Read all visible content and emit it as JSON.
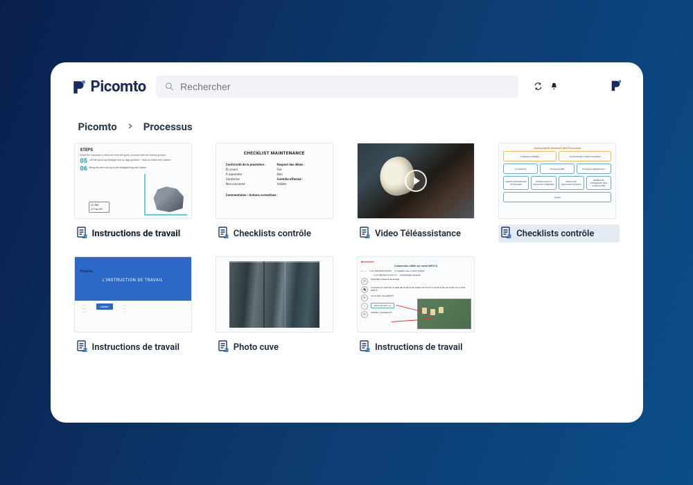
{
  "brand": "Picomto",
  "search": {
    "placeholder": "Rechercher"
  },
  "breadcrumb": {
    "root": "Picomto",
    "current": "Processus"
  },
  "cards": [
    {
      "label": "Instructions de travail",
      "bold": true,
      "selected": false,
      "type": "doc"
    },
    {
      "label": "Checklists contrôle",
      "bold": false,
      "selected": false,
      "type": "doc"
    },
    {
      "label": "Video Téléassistance",
      "bold": false,
      "selected": false,
      "type": "doc"
    },
    {
      "label": "Checklists contrôle",
      "bold": false,
      "selected": true,
      "type": "doc"
    },
    {
      "label": "Instructions de travail",
      "bold": false,
      "selected": false,
      "type": "doc"
    },
    {
      "label": "Photo cuve",
      "bold": false,
      "selected": false,
      "type": "doc"
    },
    {
      "label": "Instructions de travail",
      "bold": false,
      "selected": false,
      "type": "doc"
    }
  ],
  "thumbs": {
    "steps": {
      "title": "STEPS",
      "subtitle": "When the substrate is removed from the guest, proceed with the following steps",
      "s5": "Lift the spool up (straight arm on high position – stop on choke end), button",
      "s6": "Bring the wire end up to the straightening unit, button",
      "chk1": "HMI",
      "chk2": "Pay-off"
    },
    "checkm": {
      "title": "CHECKLIST MAINTENANCE",
      "l1": "Conformité de la prestation :",
      "l2": "En cours",
      "l3": "À reprendre",
      "l4": "Conforme",
      "l5": "Non concerné",
      "r1": "Respect des délais :",
      "r2": "Oui",
      "r3": "Non",
      "r4": "Contrôle effectué :",
      "r5": "Valider",
      "corr": "Commentaires / Actions correctives :"
    },
    "pmap": {
      "title": "Cartographie Générale des Processus",
      "b11": "Politique & stratégie",
      "b12": "Communication interne et externe",
      "b21": "Commercial",
      "b22": "Processus R&D",
      "b23": "Processus opérationnel 1",
      "b31": "Gestion administrative et financière",
      "b32": "Infrastructures et ressources matérielles",
      "b33": "Gestion des ressources humaines",
      "b34": "Système de management de la qualité et RSE",
      "b41": "Achats"
    },
    "inst2": {
      "logo": "Picomto",
      "banner": "L'INSTRUCTION DE TRAVAIL",
      "btn": "Valider"
    },
    "soco": {
      "brand": "socomec",
      "title": "Connection câble sur carte MP510",
      "row0a": "2 vis CBS M3x8 (54105)",
      "row0b": "2 rondelles crew contact (54360)",
      "row0c": "2 vis CBS M4x10 (54177)",
      "row0d": "Paramétrage visseuse",
      "row1": "Paramètre visseuse de vissage",
      "row2": "Connecter et cheminer le cable des actifs et les cables 2x2.5 mm² 2 points et les raccorder sur la carte MP510",
      "row3": "Vis 22 M3 + Rondelle Ø 3",
      "btn": "Serrer les deux vis",
      "row4": "COS M4 + Rondelle Ø 5"
    }
  },
  "colors": {
    "brand": "#1a2a5c",
    "accent": "#2c68c8",
    "selected_bg": "#e5ebf2"
  }
}
